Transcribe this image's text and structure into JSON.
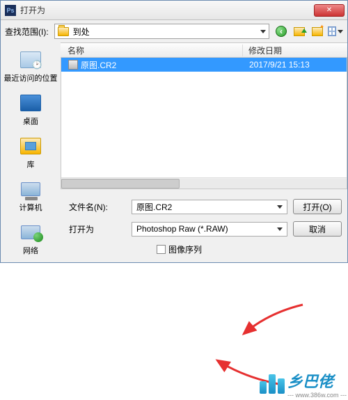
{
  "titlebar": {
    "title": "打开为",
    "app_icon_text": "Ps"
  },
  "topbar": {
    "lookin_label": "查找范围(I):",
    "path_name": "到处"
  },
  "sidebar": {
    "items": [
      {
        "label": "最近访问的位置"
      },
      {
        "label": "桌面"
      },
      {
        "label": "库"
      },
      {
        "label": "计算机"
      },
      {
        "label": "网络"
      }
    ]
  },
  "file_list": {
    "headers": {
      "name": "名称",
      "date": "修改日期"
    },
    "rows": [
      {
        "name": "原图.CR2",
        "date": "2017/9/21 15:13"
      }
    ]
  },
  "bottom": {
    "filename_label": "文件名(N):",
    "filename_value": "原图.CR2",
    "format_label": "打开为",
    "format_value": "Photoshop Raw (*.RAW)",
    "open_btn": "打开(O)",
    "cancel_btn": "取消",
    "sequence_label": "图像序列"
  },
  "watermark": {
    "text": "乡巴佬",
    "url": "--- www.386w.com ---"
  }
}
